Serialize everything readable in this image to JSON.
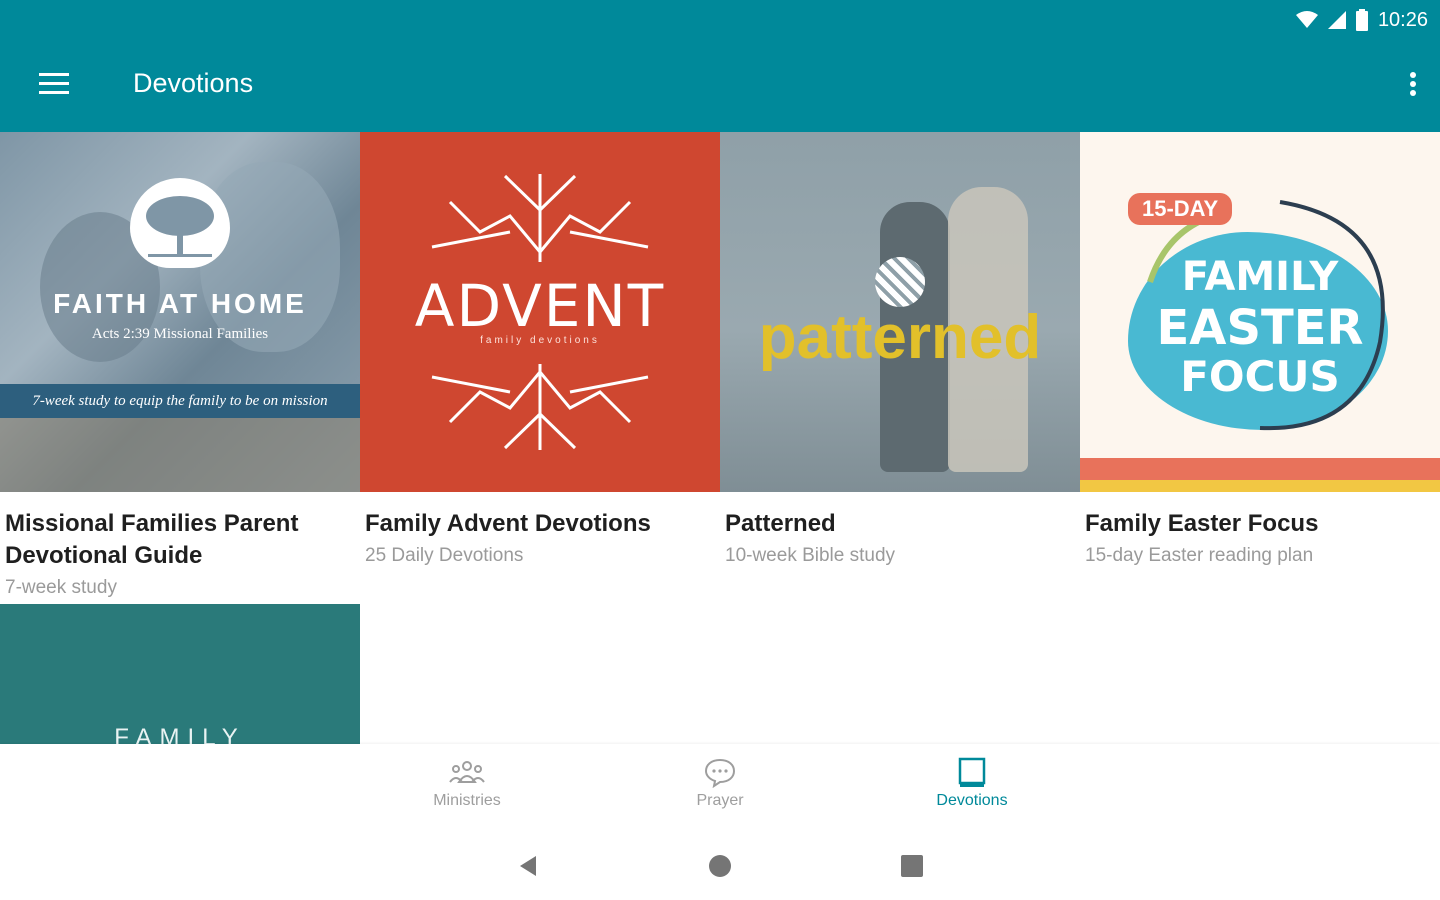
{
  "status_bar": {
    "time": "10:26"
  },
  "app_bar": {
    "title": "Devotions"
  },
  "cards": [
    {
      "title": "Missional Families  Parent Devotional Guide",
      "subtitle": "7-week study",
      "cover": {
        "brand": "FAITH AT HOME",
        "tagline": "Acts 2:39 Missional Families",
        "band": "7-week study to equip the family to be on mission"
      }
    },
    {
      "title": "Family Advent Devotions",
      "subtitle": "25 Daily Devotions",
      "cover": {
        "word": "ADVENT",
        "sub": "family devotions"
      }
    },
    {
      "title": "Patterned",
      "subtitle": "10-week Bible study",
      "cover": {
        "word": "patterned"
      }
    },
    {
      "title": "Family Easter Focus",
      "subtitle": "15-day Easter reading plan",
      "cover": {
        "badge": "15-DAY",
        "line1": "FAMILY",
        "line2": "EASTER",
        "line3": "FOCUS"
      }
    },
    {
      "cover": {
        "word": "FAMILY"
      }
    }
  ],
  "bottom_nav": {
    "active_color": "#00899a",
    "inactive_color": "#9e9e9e",
    "items": [
      {
        "label": "Ministries",
        "icon": "people-icon"
      },
      {
        "label": "Prayer",
        "icon": "chat-bubble-icon"
      },
      {
        "label": "Devotions",
        "icon": "book-icon",
        "active": true
      }
    ]
  },
  "colors": {
    "app_bar": "#00899a",
    "advent": "#cf4730",
    "patterned_text": "#e2c02a",
    "easter_blue": "#49b9d2",
    "family_teal": "#2a7a7a"
  }
}
